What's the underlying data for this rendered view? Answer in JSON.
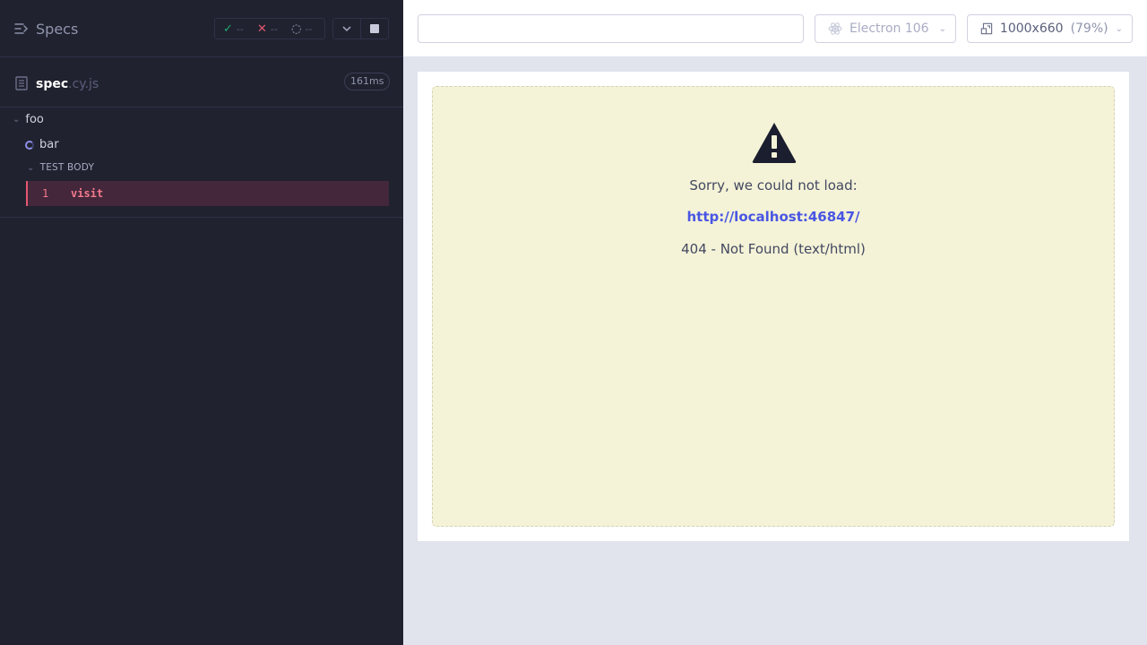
{
  "reporter": {
    "specs_label": "Specs",
    "stats": {
      "passed": "--",
      "failed": "--",
      "pending": "--"
    },
    "spec_file": {
      "name": "spec",
      "ext": ".cy.js",
      "duration": "161ms"
    },
    "tree": {
      "suite": "foo",
      "test": "bar",
      "body_label": "TEST BODY",
      "command": {
        "number": "1",
        "name": "visit"
      }
    }
  },
  "topbar": {
    "url_value": "",
    "browser": "Electron 106",
    "viewport": "1000x660",
    "viewport_scale": "(79%)"
  },
  "aut": {
    "line1": "Sorry, we could not load:",
    "url": "http://localhost:46847/",
    "line3": "404 - Not Found (text/html)"
  },
  "colors": {
    "reporter_bg": "#20222f",
    "pass": "#1fa971",
    "fail": "#e45770",
    "link": "#4956e3",
    "error_bg": "#f4f3d7"
  }
}
